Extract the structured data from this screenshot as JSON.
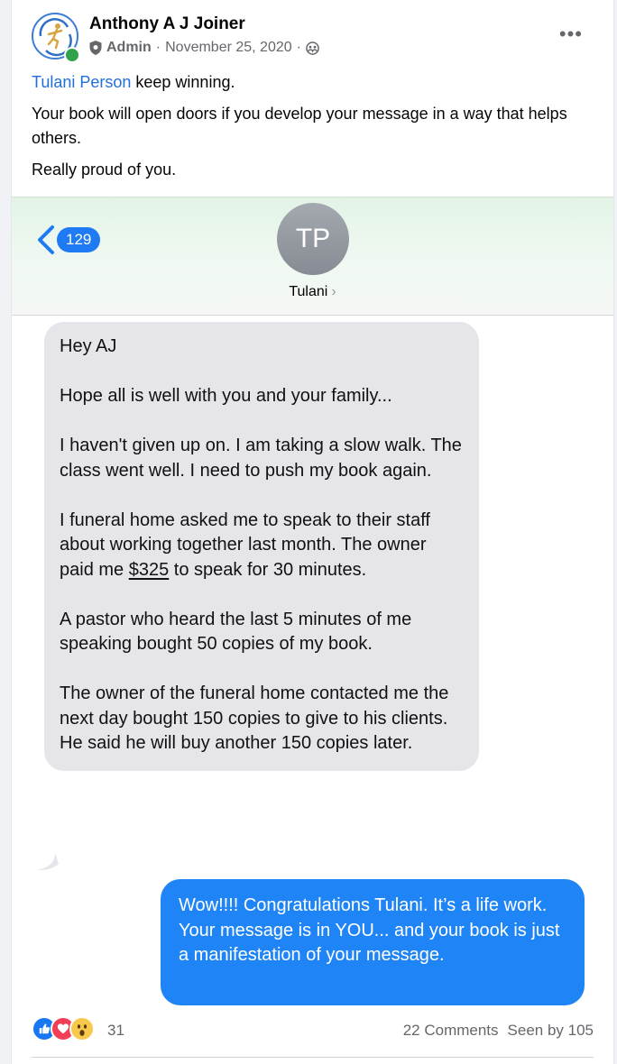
{
  "post": {
    "author": "Anthony A J Joiner",
    "role": "Admin",
    "separator": "·",
    "date": "November 25, 2020",
    "more_icon": "more-horizontal-icon",
    "privacy_icon": "group-audience-icon",
    "mention": "Tulani Person",
    "paragraph1_rest": " keep winning.",
    "paragraph2": "Your book will open doors if you develop your message in a way that helps others.",
    "paragraph3": "Really proud of you."
  },
  "screenshot": {
    "back_count": "129",
    "contact_initials": "TP",
    "contact_name": "Tulani",
    "contact_chevron": "›",
    "received": {
      "p1": "Hey AJ",
      "p2": "Hope all is well with you and your family...",
      "p3": "I haven't given up on. I am taking a slow walk. The class went well. I need to push my book again.",
      "p4_before": "I funeral home asked me to speak to their staff about working together last month. The owner paid me ",
      "p4_price": "$325",
      "p4_after": " to speak for 30 minutes.",
      "p5": "A pastor who heard the last 5 minutes of me speaking bought 50 copies of my book.",
      "p6": "The owner of the funeral home contacted me the next day bought 150 copies to give to his clients. He said he will buy another 150 copies later."
    },
    "sent": "Wow!!!! Congratulations Tulani. It’s a life work. Your message is in YOU... and your book is just a manifestation of your message."
  },
  "footer": {
    "reactions": [
      "like",
      "love",
      "wow"
    ],
    "reaction_count": "31",
    "comments": "22 Comments",
    "seen": "Seen by 105"
  },
  "colors": {
    "link": "#216fdb",
    "online": "#31a24c",
    "imessage_blue": "#1f85f7",
    "bubble_gray": "#e6e6ea"
  }
}
